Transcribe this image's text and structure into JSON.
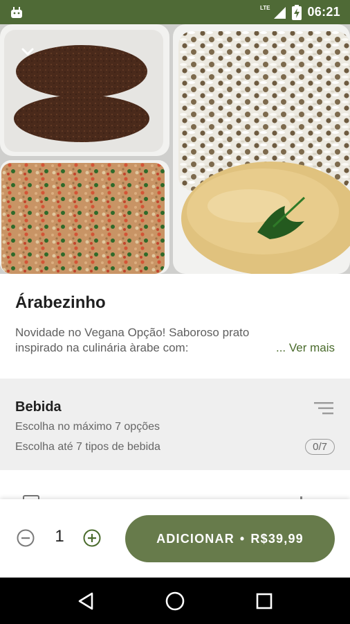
{
  "status_bar": {
    "time": "06:21",
    "network": "LTE",
    "icons": [
      "android-icon",
      "lte-signal-icon",
      "battery-charging-icon"
    ]
  },
  "hero": {
    "image_description_icon": "meal-photo",
    "collapse_icon": "chevron-down-icon"
  },
  "product": {
    "title": "Árabezinho",
    "description": "Novidade no Vegana Opção! Saboroso prato inspirado na culinária àrabe com:",
    "see_more": "... Ver mais"
  },
  "group": {
    "title": "Bebida",
    "max_options": "Escolha no máximo 7 opções",
    "choose_up_to": "Escolha até 7 tipos de bebida",
    "counter": "0/7",
    "filter_icon": "sort-icon"
  },
  "cart": {
    "quantity": "1",
    "add_label": "ADICIONAR",
    "separator": "•",
    "price": "R$39,99",
    "minus_icon": "minus-circle-icon",
    "plus_icon": "plus-circle-icon"
  },
  "navigation": {
    "back_icon": "back-triangle-icon",
    "home_icon": "home-circle-icon",
    "recents_icon": "recents-square-icon"
  },
  "colors": {
    "status_bar": "#4f6a36",
    "accent": "#677b4b",
    "accent_text": "#4a6b2c",
    "group_background": "#efefef"
  }
}
